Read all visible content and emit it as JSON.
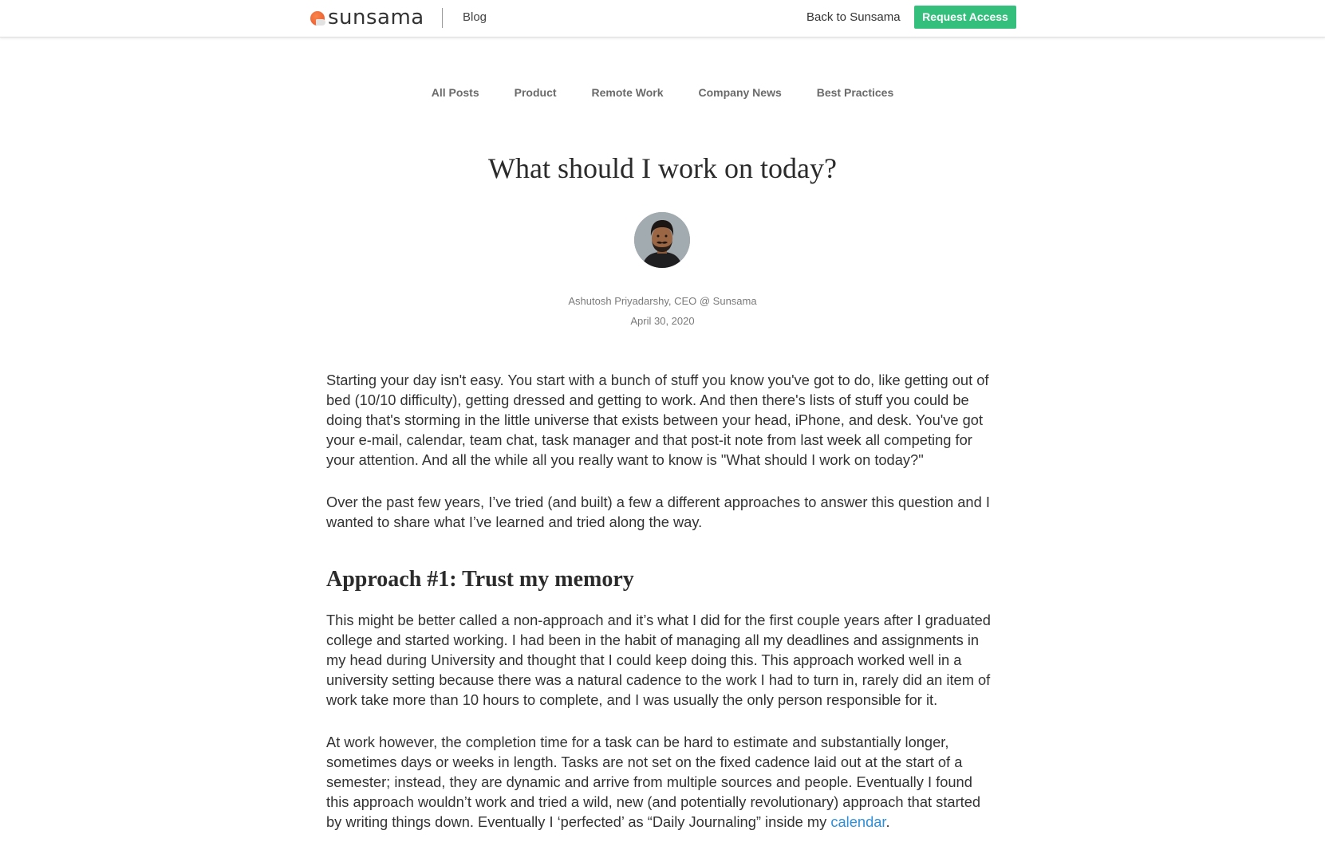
{
  "header": {
    "logo_text": "sunsama",
    "blog_label": "Blog",
    "back_label": "Back to Sunsama",
    "request_label": "Request Access"
  },
  "categories": [
    "All Posts",
    "Product",
    "Remote Work",
    "Company News",
    "Best Practices"
  ],
  "post": {
    "title": "What should I work on today?",
    "author": "Ashutosh Priyadarshy, CEO @ Sunsama",
    "date": "April 30, 2020",
    "paragraph_1": "Starting your day isn't easy. You start with a bunch of stuff you know you've got to do, like getting out of bed (10/10 difficulty), getting dressed and getting to work. And then there's lists of stuff you could be doing that's storming in the little universe that exists between your head, iPhone, and desk. You've got your e-mail, calendar, team chat, task manager and that post-it note from last week all competing for your attention. And all the while all you really want to know is \"What should I work on today?\"",
    "paragraph_2": "Over the past few years, I’ve tried (and built) a few a different approaches to answer this question and I wanted to share what I’ve learned and tried along the way.",
    "heading_1": "Approach #1: Trust my memory",
    "paragraph_3": "This might be better called a non-approach and it’s what I did for the first couple years after I graduated college and started working. I had been in the habit of managing all my deadlines and assignments in my head during University and thought that I could keep doing this. This approach worked well in a university setting because there was a natural cadence to the work I had to turn in, rarely did an item of work take more than 10 hours to complete, and I was usually the only person responsible for it.",
    "paragraph_4_text": "At work however, the completion time for a task can be hard to estimate and substantially longer, sometimes days or weeks in length. Tasks are not set on the fixed cadence laid out at the start of a semester; instead, they are dynamic and arrive from multiple sources and people. Eventually I found this approach wouldn’t work and tried a wild, new (and potentially revolutionary) approach that started by writing things down. Eventually I ‘perfected’ as “Daily Journaling” inside my ",
    "paragraph_4_link": "calendar",
    "paragraph_4_end": "."
  },
  "colors": {
    "accent_green": "#35bf7c",
    "logo_orange": "#e8542a",
    "link_blue": "#2d8fd8"
  }
}
